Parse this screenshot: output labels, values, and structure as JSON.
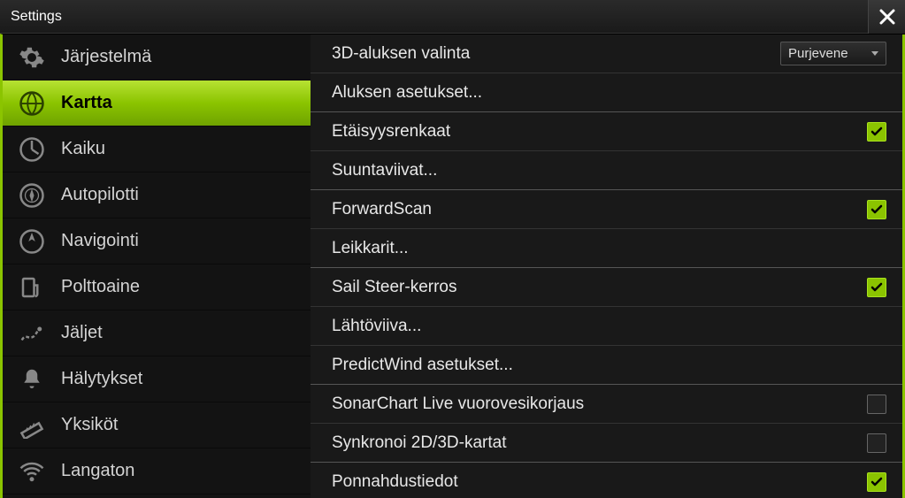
{
  "window": {
    "title": "Settings"
  },
  "sidebar": {
    "items": [
      {
        "label": "Järjestelmä",
        "icon": "gear"
      },
      {
        "label": "Kartta",
        "icon": "globe",
        "active": true
      },
      {
        "label": "Kaiku",
        "icon": "sonar"
      },
      {
        "label": "Autopilotti",
        "icon": "compass"
      },
      {
        "label": "Navigointi",
        "icon": "nav"
      },
      {
        "label": "Polttoaine",
        "icon": "fuel"
      },
      {
        "label": "Jäljet",
        "icon": "tracks"
      },
      {
        "label": "Hälytykset",
        "icon": "bell"
      },
      {
        "label": "Yksiköt",
        "icon": "ruler"
      },
      {
        "label": "Langaton",
        "icon": "wifi"
      }
    ]
  },
  "content": {
    "rows": [
      {
        "label": "3D-aluksen valinta",
        "type": "select",
        "value": "Purjevene",
        "sep": "light"
      },
      {
        "label": "Aluksen asetukset...",
        "type": "link"
      },
      {
        "label": "Etäisyysrenkaat",
        "type": "checkbox",
        "checked": true,
        "sep": "light"
      },
      {
        "label": "Suuntaviivat...",
        "type": "link"
      },
      {
        "label": "ForwardScan",
        "type": "checkbox",
        "checked": true,
        "sep": "light"
      },
      {
        "label": "Leikkarit...",
        "type": "link"
      },
      {
        "label": "Sail Steer-kerros",
        "type": "checkbox",
        "checked": true,
        "sep": "light"
      },
      {
        "label": "Lähtöviiva...",
        "type": "link",
        "sep": "light"
      },
      {
        "label": "PredictWind asetukset...",
        "type": "link"
      },
      {
        "label": "SonarChart Live vuorovesikorjaus",
        "type": "checkbox",
        "checked": false,
        "sep": "light"
      },
      {
        "label": "Synkronoi 2D/3D-kartat",
        "type": "checkbox",
        "checked": false
      },
      {
        "label": "Ponnahdustiedot",
        "type": "checkbox",
        "checked": true
      }
    ]
  }
}
